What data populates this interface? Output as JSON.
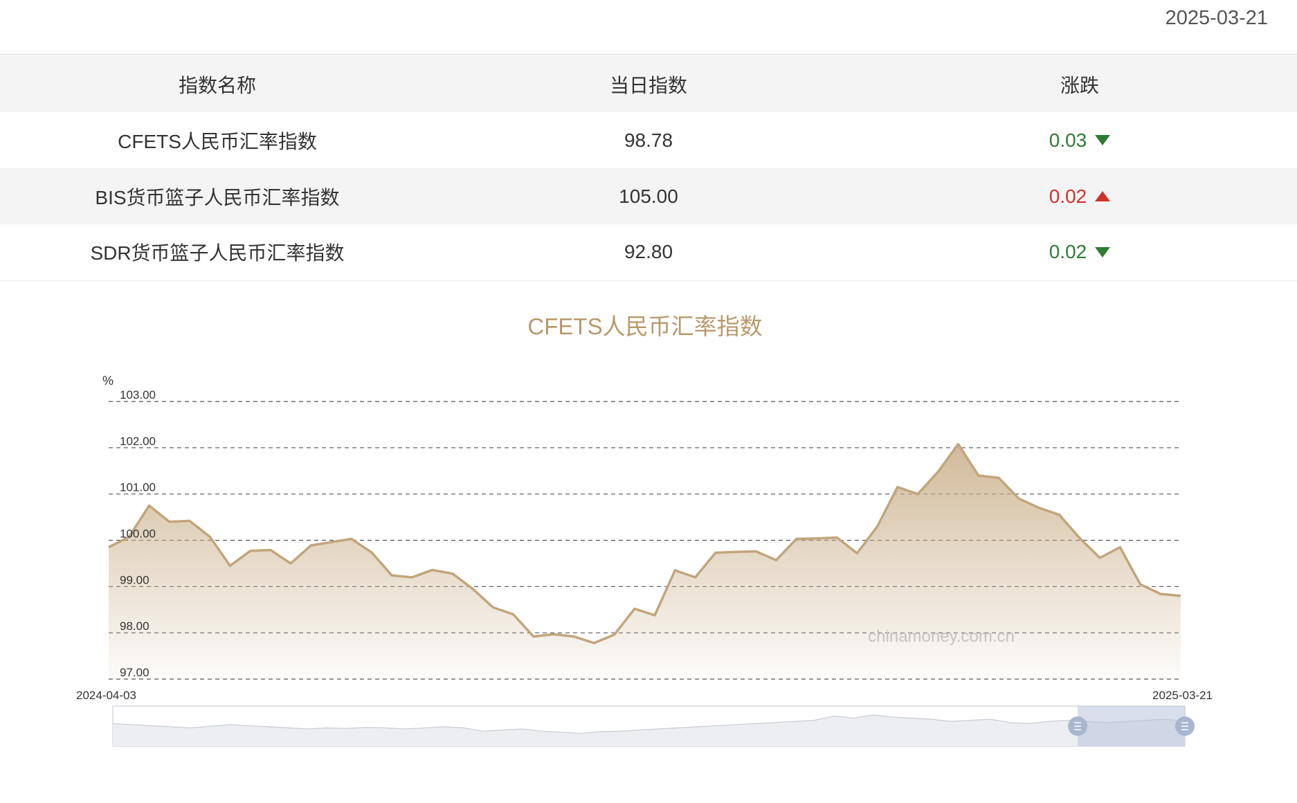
{
  "header": {
    "date": "2025-03-21"
  },
  "table": {
    "headers": [
      "指数名称",
      "当日指数",
      "涨跌"
    ],
    "rows": [
      {
        "name": "CFETS人民币汇率指数",
        "value": "98.78",
        "change": "0.03",
        "direction": "down"
      },
      {
        "name": "BIS货币篮子人民币汇率指数",
        "value": "105.00",
        "change": "0.02",
        "direction": "up"
      },
      {
        "name": "SDR货币篮子人民币汇率指数",
        "value": "92.80",
        "change": "0.02",
        "direction": "down"
      }
    ]
  },
  "colors": {
    "down": "#2e7d32",
    "up": "#d0312d",
    "line": "#c2a57c",
    "title": "#b8986a"
  },
  "chart_data": {
    "type": "area",
    "title": "CFETS人民币汇率指数",
    "ylabel": "%",
    "ylim": [
      97,
      103
    ],
    "yticks": [
      "103.00",
      "102.00",
      "101.00",
      "100.00",
      "99.00",
      "98.00",
      "97.00"
    ],
    "x_start_label": "2024-04-03",
    "x_end_label": "2025-03-21",
    "watermark": "chinamoney.com.cn",
    "grid": true,
    "series": [
      {
        "values": [
          99.85,
          100.07,
          100.75,
          100.4,
          100.42,
          100.08,
          99.45,
          99.77,
          99.79,
          99.5,
          99.89,
          99.96,
          100.03,
          99.74,
          99.24,
          99.2,
          99.36,
          99.28,
          98.95,
          98.55,
          98.4,
          97.92,
          97.97,
          97.92,
          97.78,
          97.96,
          98.52,
          98.38,
          99.35,
          99.2,
          99.73,
          99.75,
          99.76,
          99.57,
          100.03,
          100.04,
          100.06,
          99.72,
          100.3,
          101.15,
          101.0,
          101.48,
          102.08,
          101.4,
          101.35,
          100.9,
          100.7,
          100.55,
          100.05,
          99.62,
          99.85,
          99.05,
          98.84,
          98.8
        ]
      }
    ],
    "overview": {
      "values": [
        99.7,
        99.6,
        99.5,
        99.4,
        99.3,
        99.45,
        99.6,
        99.5,
        99.4,
        99.3,
        99.2,
        99.3,
        99.25,
        99.35,
        99.3,
        99.2,
        99.3,
        99.4,
        99.3,
        99.0,
        99.1,
        99.2,
        99.0,
        98.9,
        98.8,
        98.95,
        99.0,
        99.1,
        99.2,
        99.3,
        99.4,
        99.5,
        99.6,
        99.7,
        99.8,
        99.9,
        100.0,
        100.4,
        100.2,
        100.5,
        100.3,
        100.2,
        100.1,
        99.9,
        100.0,
        100.1,
        99.8,
        99.7,
        99.9,
        100.0,
        99.9,
        99.8,
        99.9,
        100.0,
        100.1,
        99.9
      ],
      "range_start": 0.9,
      "range_end": 1.0
    }
  }
}
